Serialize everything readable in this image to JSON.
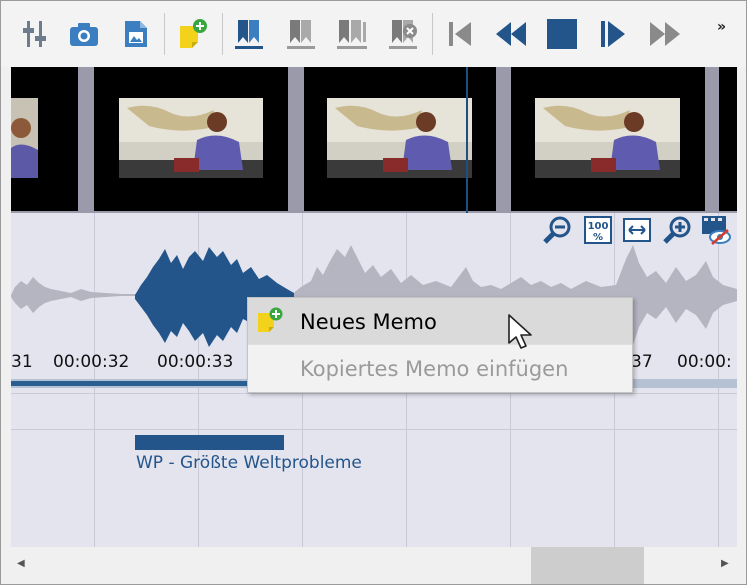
{
  "toolbar": {
    "buttons": [
      "settings-sliders",
      "camera",
      "image-export",
      "new-memo",
      "bookmark-blue",
      "bookmark-gray",
      "bookmark-double",
      "bookmark-remove",
      "skip-to-start",
      "rewind",
      "stop",
      "play",
      "fast-forward"
    ],
    "overflow_label": "»"
  },
  "timeline": {
    "ticks": [
      "31",
      "00:00:32",
      "00:00:33",
      "37",
      "00:00:"
    ]
  },
  "coding": {
    "label": "WP - Größte Weltprobleme",
    "color": "#23558a"
  },
  "context_menu": {
    "items": [
      {
        "label": "Neues Memo",
        "enabled": true
      },
      {
        "label": "Kopiertes Memo einfügen",
        "enabled": false
      }
    ]
  },
  "scrollbar": {
    "left_arrow": "◀",
    "right_arrow": "▶"
  }
}
